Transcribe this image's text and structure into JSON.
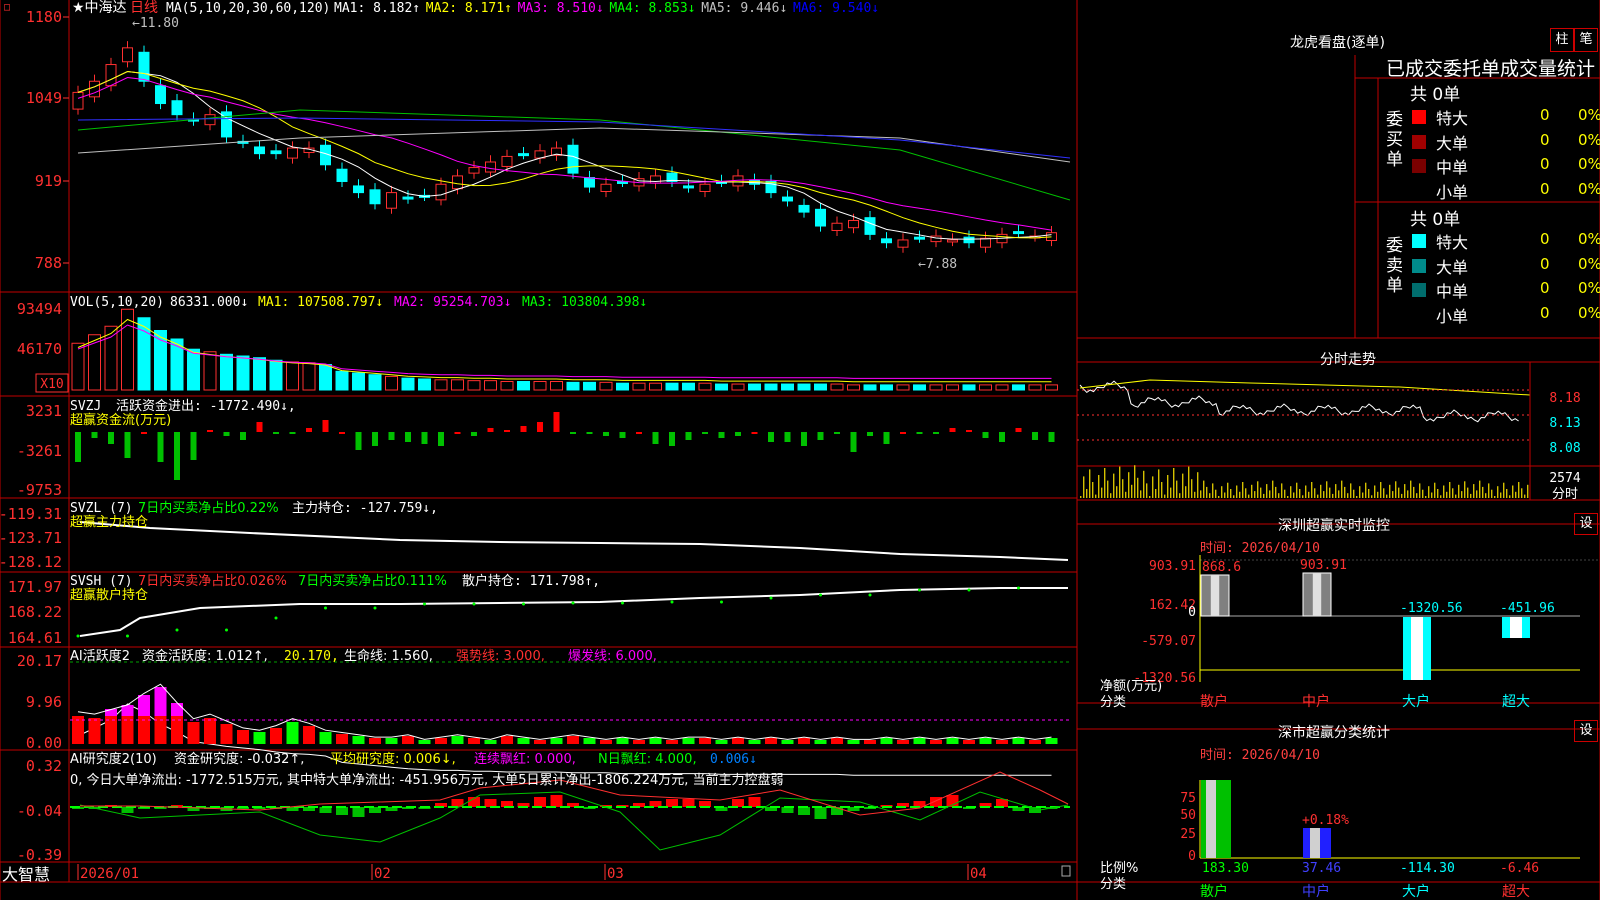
{
  "app": {
    "brand": "大智慧",
    "corner_marker": "□"
  },
  "stock": {
    "star": "★",
    "name": "中海达",
    "period": "日线"
  },
  "price_panel": {
    "ma_label": "MA(5,10,20,30,60,120)",
    "ma_values": [
      {
        "label": "MA1:",
        "value": "8.182↑",
        "color": "#ffffff"
      },
      {
        "label": "MA2:",
        "value": "8.171↑",
        "color": "#ffff00"
      },
      {
        "label": "MA3:",
        "value": "8.510↓",
        "color": "#ff00ff"
      },
      {
        "label": "MA4:",
        "value": "8.853↓",
        "color": "#00ff00"
      },
      {
        "label": "MA5:",
        "value": "9.446↓",
        "color": "#c0c0c0"
      },
      {
        "label": "MA6:",
        "value": "9.540↓",
        "color": "#0000ff"
      }
    ],
    "y_ticks": [
      "1180",
      "1049",
      "919",
      "788"
    ],
    "high_note": "←11.80",
    "low_note": "←7.88"
  },
  "vol_panel": {
    "label": "VOL(5,10,20)",
    "value": "86331.000↓",
    "ma1": "MA1: 107508.797↓",
    "ma2": "MA2: 95254.703↓",
    "ma3": "MA3: 103804.398↓",
    "y_ticks": [
      "93494",
      "46170"
    ],
    "unit": "X10"
  },
  "svzj_panel": {
    "label": "SVZJ",
    "title": "活跃资金进出: -1772.490↓,",
    "subtitle": "超赢资金流(万元)",
    "y_ticks": [
      "3231",
      "-3261",
      "-9753"
    ]
  },
  "svzl_panel": {
    "label": "SVZL (7)",
    "a": "7日内买卖净占比0.22%",
    "b": "主力持仓: -127.759↓,",
    "subtitle": "超赢主力持仓",
    "y_ticks": [
      "-119.31",
      "-123.71",
      "-128.12"
    ]
  },
  "svsh_panel": {
    "label": "SVSH (7)",
    "a": "7日内买卖净占比0.026%",
    "b": "7日内买卖净占比0.111%",
    "c": "散户持仓: 171.798↑,",
    "subtitle": "超赢散户持仓",
    "y_ticks": [
      "171.97",
      "168.22",
      "164.61"
    ]
  },
  "ai_hyd_panel": {
    "label": "AI活跃度2",
    "a": "资金活跃度: 1.012↑,",
    "b": "20.170,",
    "c": "生命线: 1.560,",
    "d": "强势线: 3.000,",
    "e": "爆发线: 6.000,",
    "y_ticks": [
      "20.17",
      "9.96",
      "0.00"
    ]
  },
  "ai_yjd_panel": {
    "label": "AI研究度2(10)",
    "a": "资金研究度: -0.032↑,",
    "b": "平均研究度: 0.006↓,",
    "c": "连续飘红: 0.000,",
    "d": "N日飘红: 4.000,",
    "e": "0.006↓",
    "note": "0, 今日大单净流出: -1772.515万元, 其中特大单净流出: -451.956万元, 大单5日累计净出-1806.224万元, 当前主力控盘弱",
    "y_ticks": [
      "0.32",
      "-0.04",
      "-0.39"
    ]
  },
  "x_axis": {
    "labels": [
      "2026/01",
      "02",
      "03",
      "04"
    ]
  },
  "right": {
    "longhu_title": "龙虎看盘(逐单)",
    "btn_zhu": "柱",
    "btn_bi": "笔",
    "stat_title": "已成交委托单成交量统计",
    "buy_header": "共 0单",
    "buy_side": "委买单",
    "sell_header": "共 0单",
    "sell_side": "委卖单",
    "rows_buy": [
      {
        "name": "特大",
        "v": "0",
        "p": "0%",
        "c": "#ff0000"
      },
      {
        "name": "大单",
        "v": "0",
        "p": "0%",
        "c": "#a00000"
      },
      {
        "name": "中单",
        "v": "0",
        "p": "0%",
        "c": "#7a0000"
      },
      {
        "name": "小单",
        "v": "0",
        "p": "0%",
        "c": "#000000"
      }
    ],
    "rows_sell": [
      {
        "name": "特大",
        "v": "0",
        "p": "0%",
        "c": "#00ffff"
      },
      {
        "name": "大单",
        "v": "0",
        "p": "0%",
        "c": "#008b8b"
      },
      {
        "name": "中单",
        "v": "0",
        "p": "0%",
        "c": "#006d6d"
      },
      {
        "name": "小单",
        "v": "0",
        "p": "0%",
        "c": "#000000"
      }
    ],
    "intraday_title": "分时走势",
    "intraday_ticks": [
      "8.18",
      "8.13",
      "8.08"
    ],
    "intraday_vol": "2574",
    "intraday_vol_label": "分时",
    "sz_title": "深圳超赢实时监控",
    "sz_set": "设",
    "sz_time": "时间: 2026/04/10",
    "sz_ticks": [
      "903.91",
      "162.42",
      "0",
      "-579.07",
      "-1320.56"
    ],
    "sz_values": {
      "sanhu": "868.6",
      "zhonghu": "903.91",
      "dahu": "-1320.56",
      "chaoda": "-451.96"
    },
    "sz_ylabel": "净额(万元)",
    "sz_xlabel": "分类",
    "sz_cats": [
      "散户",
      "中户",
      "大户",
      "超大"
    ],
    "fl_title": "深市超赢分类统计",
    "fl_set": "设",
    "fl_time": "时间: 2026/04/10",
    "fl_ticks": [
      "75",
      "50",
      "25",
      "0"
    ],
    "fl_pct": "+0.18%",
    "fl_ylabel": "比例%",
    "fl_xlabel": "分类",
    "fl_values": [
      "183.30",
      "37.46",
      "-114.30",
      "-6.46"
    ],
    "fl_cats": [
      "散户",
      "中户",
      "大户",
      "超大"
    ]
  }
}
